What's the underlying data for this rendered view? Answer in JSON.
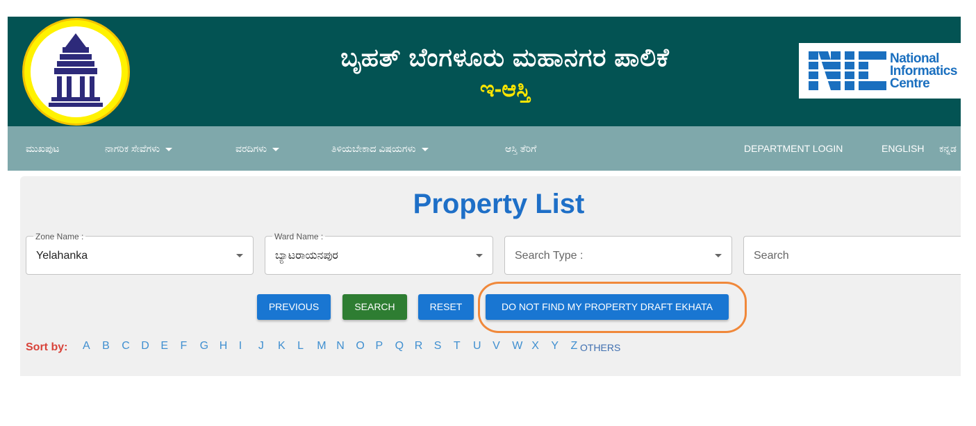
{
  "header": {
    "title_kannada": "ಬೃಹತ್ ಬೆಂಗಳೂರು ಮಹಾನಗರ ಪಾಲಿಕೆ",
    "subtitle_kannada": "ಇ-ಆಸ್ತಿ",
    "nic_text": [
      "National",
      "Informatics",
      "Centre"
    ],
    "nic_mark_text": "NIC"
  },
  "nav": {
    "items": [
      {
        "label": "ಮುಖಪುಟ",
        "dropdown": false
      },
      {
        "label": "ನಾಗರಿಕ ಸೇವೆಗಳು",
        "dropdown": true
      },
      {
        "label": "ವರದಿಗಳು",
        "dropdown": true
      },
      {
        "label": "ತಿಳಿಯಬೇಕಾದ ವಿಷಯಗಳು",
        "dropdown": true
      },
      {
        "label": "ಆಸ್ತಿ ತೆರಿಗೆ",
        "dropdown": false
      }
    ],
    "department_login": "DEPARTMENT LOGIN",
    "english": "ENGLISH",
    "kannada": "ಕನ್ನಡ"
  },
  "main": {
    "title": "Property List",
    "zone": {
      "label": "Zone Name :",
      "value": "Yelahanka"
    },
    "ward": {
      "label": "Ward Name :",
      "value": "ಬ್ಯಾಟರಾಯನಪುರ"
    },
    "search_type": {
      "placeholder": "Search Type :"
    },
    "search": {
      "placeholder": "Search"
    },
    "buttons": {
      "previous": "PREVIOUS",
      "search": "SEARCH",
      "reset": "RESET",
      "draft_ekhata": "DO NOT FIND MY PROPERTY DRAFT EKHATA"
    },
    "sort": {
      "label": "Sort by:",
      "letters": [
        "A",
        "B",
        "C",
        "D",
        "E",
        "F",
        "G",
        "H",
        "I",
        "J",
        "K",
        "L",
        "M",
        "N",
        "O",
        "P",
        "Q",
        "R",
        "S",
        "T",
        "U",
        "V",
        "W",
        "X",
        "Y",
        "Z"
      ],
      "others": "OTHERS"
    }
  },
  "colors": {
    "header_bg": "#035353",
    "nav_bg": "#7fa8ab",
    "title_blue": "#1e6fc7",
    "primary_button": "#1976d2",
    "search_button": "#2e7d32",
    "highlight_outline": "#f0883a",
    "sort_label": "#d8433a"
  }
}
